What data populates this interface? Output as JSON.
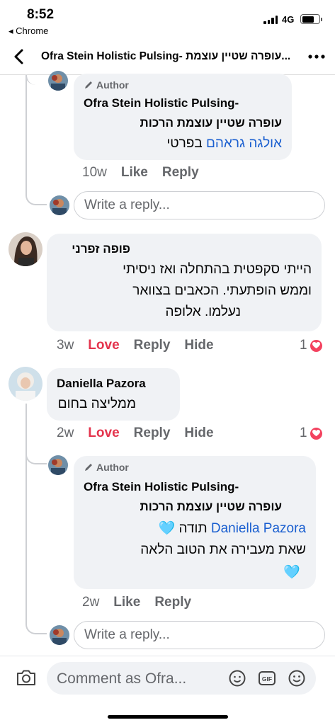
{
  "status_bar": {
    "time": "8:52",
    "back_app": "◂ Chrome",
    "network": "4G",
    "battery_level": 0.7
  },
  "header": {
    "title": "Ofra Stein Holistic Pulsing- עופרה שטיין עוצמת..."
  },
  "author_tag": "Author",
  "comment1": {
    "name_line1": "Ofra Stein Holistic Pulsing-",
    "name_line2": "עופרה שטיין עוצמת הרכות",
    "mention": "אולגה גראהם",
    "text": "בפרטי",
    "time": "10w",
    "like": "Like",
    "reply": "Reply"
  },
  "reply_placeholder": "Write a reply...",
  "comment2": {
    "name": "פופה זפרני",
    "lines": [
      "הייתי סקפטית בהתחלה ואז ניסיתי",
      "וממש הופתעתי. הכאבים בצוואר",
      "נעלמו. אלופה"
    ],
    "time": "3w",
    "love": "Love",
    "reply": "Reply",
    "hide": "Hide",
    "reactions": "1"
  },
  "comment3": {
    "name": "Daniella Pazora",
    "text": "ממליצה בחום",
    "time": "2w",
    "love": "Love",
    "reply": "Reply",
    "hide": "Hide",
    "reactions": "1"
  },
  "comment4": {
    "name_line1": "Ofra Stein Holistic Pulsing-",
    "name_line2": "עופרה שטיין עוצמת הרכות",
    "mention": "Daniella Pazora",
    "text1": "תודה",
    "heart1": "🩵",
    "text2": "שאת מעבירה את הטוב הלאה",
    "heart2": "🩵",
    "time": "2w",
    "like": "Like",
    "reply": "Reply"
  },
  "bottom_bar": {
    "placeholder": "Comment as Ofra..."
  },
  "colors": {
    "accent": "#1a5fd0",
    "love": "#e4344d",
    "bubble": "#f0f2f5",
    "secondary_text": "#65676b"
  },
  "icons": [
    "back-chevron-icon",
    "more-icon",
    "camera-icon",
    "sticker-icon",
    "gif-icon",
    "emoji-icon",
    "heart-icon",
    "pencil-icon"
  ]
}
